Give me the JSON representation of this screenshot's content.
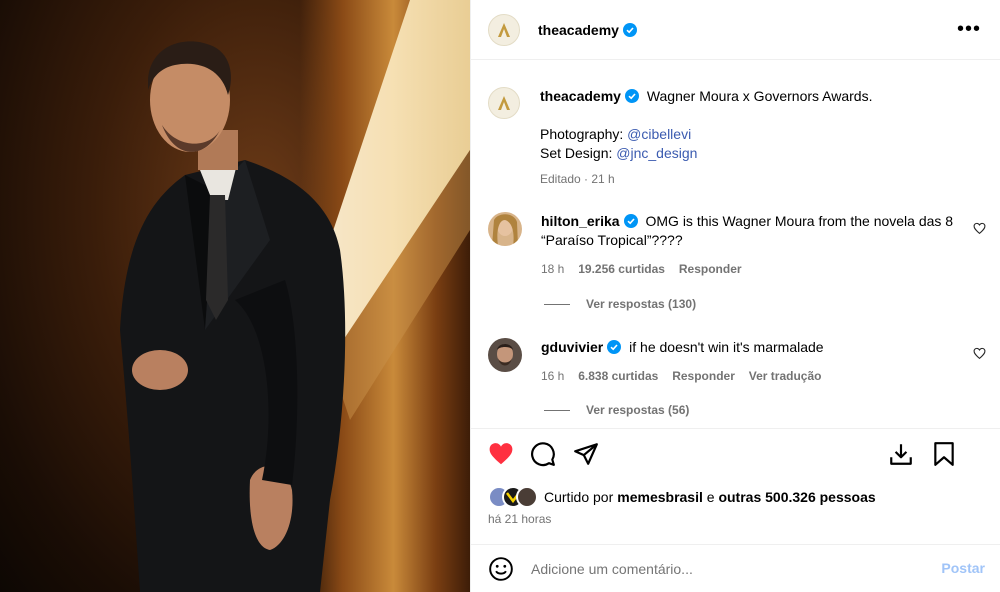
{
  "post": {
    "username": "theacademy",
    "caption_text": "Wagner Moura x Governors Awards.",
    "credit1_label": "Photography: ",
    "credit1_handle": "@cibellevi",
    "credit2_label": "Set Design: ",
    "credit2_handle": "@jnc_design",
    "edited": "Editado · 21 h"
  },
  "comments": [
    {
      "username": "hilton_erika",
      "text": "OMG is this Wagner Moura from the novela das 8 “Paraíso Tropical”????",
      "time": "18 h",
      "likes": "19.256 curtidas",
      "reply": "Responder",
      "view_replies": "Ver respostas (130)"
    },
    {
      "username": "gduvivier",
      "text": "if he doesn't win it's marmalade",
      "time": "16 h",
      "likes": "6.838 curtidas",
      "reply": "Responder",
      "translate": "Ver tradução",
      "view_replies": "Ver respostas (56)"
    }
  ],
  "likes_summary": {
    "prefix": "Curtido por ",
    "user": "memesbrasil",
    "middle": " e ",
    "others": "outras 500.326 pessoas"
  },
  "posted_ago": "há 21 horas",
  "add_comment": {
    "placeholder": "Adicione um comentário...",
    "post_label": "Postar"
  },
  "colors": {
    "like_red": "#ff3040",
    "verified_blue": "#0095f6",
    "link_blue": "#3b5bb0",
    "post_button": "#a0c4f8"
  },
  "icons": [
    "more-options-icon",
    "heart-icon",
    "comment-icon",
    "share-icon",
    "download-icon",
    "bookmark-icon",
    "emoji-icon"
  ]
}
